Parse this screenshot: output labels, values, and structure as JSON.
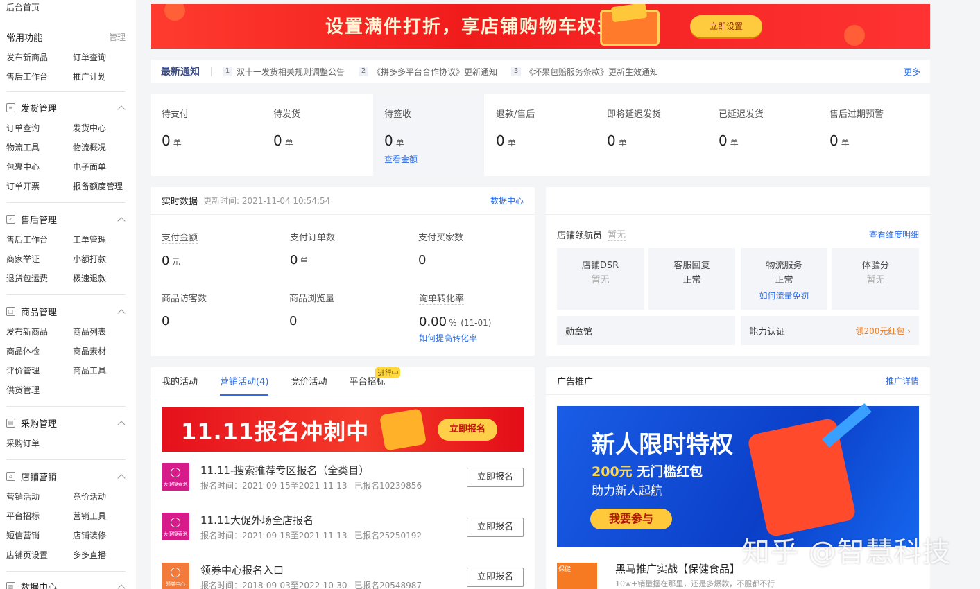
{
  "sidebar": {
    "home": "后台首页",
    "common": {
      "title": "常用功能",
      "manage": "管理",
      "items": [
        "发布新商品",
        "订单查询",
        "售后工作台",
        "推广计划"
      ]
    },
    "shipping": {
      "title": "发货管理",
      "items": [
        "订单查询",
        "发货中心",
        "物流工具",
        "物流概况",
        "包裹中心",
        "电子面单",
        "订单开票",
        "报备额度管理"
      ]
    },
    "aftersale": {
      "title": "售后管理",
      "items": [
        "售后工作台",
        "工单管理",
        "商家举证",
        "小额打款",
        "退货包运费",
        "极速退款"
      ]
    },
    "goods": {
      "title": "商品管理",
      "items": [
        "发布新商品",
        "商品列表",
        "商品体检",
        "商品素材",
        "评价管理",
        "商品工具",
        "供货管理"
      ]
    },
    "purchase": {
      "title": "采购管理",
      "items": [
        "采购订单"
      ]
    },
    "marketing": {
      "title": "店铺营销",
      "items": [
        "营销活动",
        "竞价活动",
        "平台招标",
        "营销工具",
        "短信营销",
        "店铺装修",
        "店铺页设置",
        "多多直播"
      ]
    },
    "data": {
      "title": "数据中心"
    }
  },
  "banner": {
    "text": "设置满件打折，享店铺购物车权益",
    "button": "立即设置"
  },
  "notice": {
    "title": "最新通知",
    "items": [
      {
        "num": "1",
        "text": "双十一发货相关规则调整公告"
      },
      {
        "num": "2",
        "text": "《拼多多平台合作协议》更新通知"
      },
      {
        "num": "3",
        "text": "《坏果包赔服务条款》更新生效通知"
      }
    ],
    "more": "更多"
  },
  "orders": {
    "unit": "单",
    "link": "查看金额",
    "items": [
      {
        "label": "待支付",
        "value": "0"
      },
      {
        "label": "待发货",
        "value": "0"
      },
      {
        "label": "待签收",
        "value": "0"
      },
      {
        "label": "退款/售后",
        "value": "0"
      },
      {
        "label": "即将延迟发货",
        "value": "0"
      },
      {
        "label": "已延迟发货",
        "value": "0"
      },
      {
        "label": "售后过期预警",
        "value": "0"
      }
    ]
  },
  "realtime": {
    "title": "实时数据",
    "updated": "更新时间: 2021-11-04 10:54:54",
    "link": "数据中心",
    "metrics": [
      {
        "label": "支付金额",
        "value": "0",
        "unit": "元"
      },
      {
        "label": "支付订单数",
        "value": "0",
        "unit": "单"
      },
      {
        "label": "支付买家数",
        "value": "0",
        "unit": ""
      },
      {
        "label": "商品访客数",
        "value": "0",
        "unit": ""
      },
      {
        "label": "商品浏览量",
        "value": "0",
        "unit": ""
      },
      {
        "label": "询单转化率",
        "value": "0.00",
        "unit": "%",
        "date": "(11-01)",
        "link": "如何提高转化率"
      }
    ]
  },
  "dsr": {
    "navigator": "店铺领航员",
    "navigator_status": "暂无",
    "detail_link": "查看维度明细",
    "boxes": [
      {
        "title": "店铺DSR",
        "status": "暂无"
      },
      {
        "title": "客服回复",
        "status": "正常"
      },
      {
        "title": "物流服务",
        "status": "正常",
        "link": "如何流量免罚"
      },
      {
        "title": "体验分",
        "status": "暂无"
      }
    ],
    "medal": "勋章馆",
    "ability": "能力认证",
    "ability_link": "领200元红包"
  },
  "activities": {
    "tabs": [
      "我的活动",
      "营销活动(4)",
      "竞价活动",
      "平台招标"
    ],
    "badge": "进行中",
    "promo": {
      "title": "11.11报名冲刺中",
      "button": "立即报名"
    },
    "rows": [
      {
        "icon": "大促搜索池",
        "title": "11.11-搜索推荐专区报名（全类目）",
        "time": "报名时间：2021-09-15至2021-11-13",
        "count": "已报名10239856",
        "button": "立即报名"
      },
      {
        "icon": "大促搜索池",
        "title": "11.11大促外场全店报名",
        "time": "报名时间：2021-09-18至2021-11-13",
        "count": "已报名25250192",
        "button": "立即报名"
      },
      {
        "icon": "领券中心",
        "title": "领券中心报名入口",
        "time": "报名时间：2018-09-03至2022-10-30",
        "count": "已报名20548987",
        "button": "立即报名"
      }
    ]
  },
  "ads": {
    "title": "广告推广",
    "link": "推广详情",
    "banner": {
      "t1": "新人限时特权",
      "t2a": "200元",
      "t2b": "无门槛红包",
      "t3": "助力新人起航",
      "button": "我要参与"
    },
    "row": {
      "icon": "保健",
      "title": "黑马推广实战【保健食品】",
      "sub": "10w+销量摆在那里，还是多爆款，不服都不行"
    }
  },
  "watermark": "知乎 @智慧科技"
}
